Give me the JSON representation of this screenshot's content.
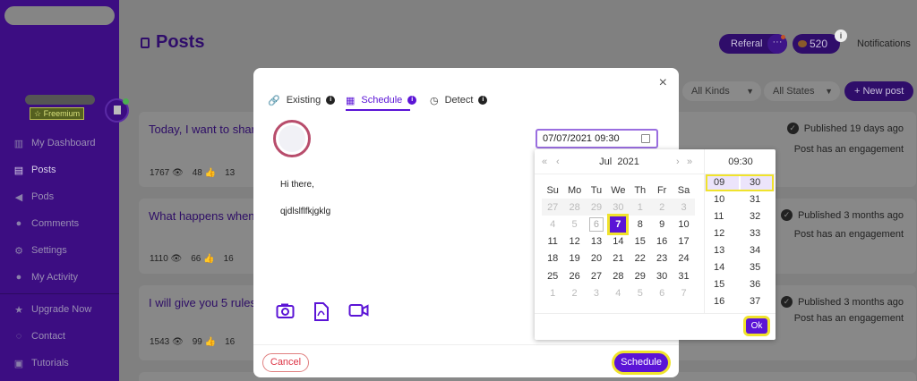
{
  "sidebar": {
    "plan_badge": "☆ Freemium",
    "nav": [
      {
        "label": "My Dashboard",
        "icon": "bar-chart-icon"
      },
      {
        "label": "Posts",
        "icon": "document-icon"
      },
      {
        "label": "Pods",
        "icon": "megaphone-icon"
      },
      {
        "label": "Comments",
        "icon": "chat-bubble-icon"
      },
      {
        "label": "Settings",
        "icon": "gear-icon"
      },
      {
        "label": "My Activity",
        "icon": "user-icon"
      },
      {
        "label": "Upgrade Now",
        "icon": "star-icon"
      },
      {
        "label": "Contact",
        "icon": "speech-icon"
      },
      {
        "label": "Tutorials",
        "icon": "video-icon"
      }
    ]
  },
  "header": {
    "title": "Posts",
    "referal": "Referal",
    "referal_more": "···",
    "coins": "520",
    "coins_info": "i",
    "notifications": "Notifications"
  },
  "filters": {
    "kinds": "All Kinds",
    "states": "All States",
    "new_post": "+  New post"
  },
  "posts": [
    {
      "title": "Today, I want to share",
      "views": "1767",
      "likes": "48",
      "comments": "13",
      "status": "Published 19 days ago",
      "engagement": "Post has an engagement"
    },
    {
      "title": "What happens when",
      "views": "1110",
      "likes": "66",
      "comments": "16",
      "status": "Published 3 months ago",
      "engagement": "Post has an engagement"
    },
    {
      "title": "I will give you 5 rules",
      "views": "1543",
      "likes": "99",
      "comments": "16",
      "status": "Published 3 months ago",
      "engagement": "Post has an engagement"
    }
  ],
  "modal": {
    "close": "×",
    "tabs": [
      {
        "label": "Existing",
        "icon": "link-icon"
      },
      {
        "label": "Schedule",
        "icon": "calendar-icon"
      },
      {
        "label": "Detect",
        "icon": "clock-icon"
      }
    ],
    "tab_info": "i",
    "active_tab": "Schedule",
    "message_lines": [
      "Hi there,",
      "qjdlslflfkjgklg"
    ],
    "datetime_value": "07/07/2021 09:30",
    "cancel": "Cancel",
    "schedule": "Schedule"
  },
  "picker": {
    "month": "Jul",
    "year": "2021",
    "nav_prev_year": "«",
    "nav_prev": "‹",
    "nav_next": "›",
    "nav_next_year": "»",
    "weekdays": [
      "Su",
      "Mo",
      "Tu",
      "We",
      "Th",
      "Fr",
      "Sa"
    ],
    "weeks": [
      [
        "27",
        "28",
        "29",
        "30",
        "1",
        "2",
        "3"
      ],
      [
        "4",
        "5",
        "6",
        "7",
        "8",
        "9",
        "10"
      ],
      [
        "11",
        "12",
        "13",
        "14",
        "15",
        "16",
        "17"
      ],
      [
        "18",
        "19",
        "20",
        "21",
        "22",
        "23",
        "24"
      ],
      [
        "25",
        "26",
        "27",
        "28",
        "29",
        "30",
        "31"
      ],
      [
        "1",
        "2",
        "3",
        "4",
        "5",
        "6",
        "7"
      ]
    ],
    "selected_day": "7",
    "today_day": "6",
    "time_header": "09:30",
    "hours": [
      "09",
      "10",
      "11",
      "12",
      "13",
      "14",
      "15",
      "16"
    ],
    "minutes": [
      "30",
      "31",
      "32",
      "33",
      "34",
      "35",
      "36",
      "37"
    ],
    "ok": "Ok"
  }
}
